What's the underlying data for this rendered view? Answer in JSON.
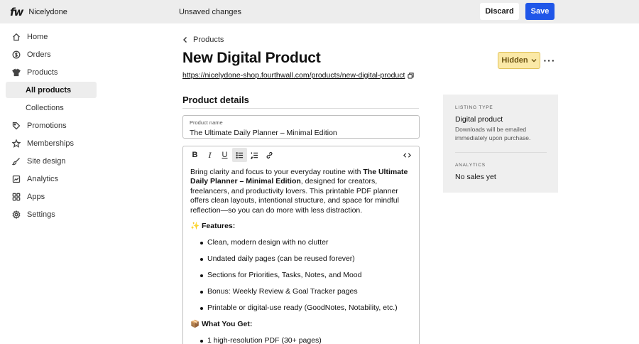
{
  "app": {
    "logo_text": "fw",
    "store_name": "Nicelydone",
    "unsaved_text": "Unsaved changes",
    "discard_label": "Discard",
    "save_label": "Save"
  },
  "sidebar": {
    "items": [
      {
        "label": "Home",
        "icon": "home-icon"
      },
      {
        "label": "Orders",
        "icon": "orders-icon"
      },
      {
        "label": "Products",
        "icon": "shirt-icon"
      },
      {
        "label": "All products",
        "icon": ""
      },
      {
        "label": "Collections",
        "icon": ""
      },
      {
        "label": "Promotions",
        "icon": "tag-icon"
      },
      {
        "label": "Memberships",
        "icon": "star-icon"
      },
      {
        "label": "Site design",
        "icon": "brush-icon"
      },
      {
        "label": "Analytics",
        "icon": "chart-icon"
      },
      {
        "label": "Apps",
        "icon": "apps-icon"
      },
      {
        "label": "Settings",
        "icon": "gear-icon"
      }
    ]
  },
  "main": {
    "breadcrumb": "Products",
    "title": "New Digital Product",
    "url": "https://nicelydone-shop.fourthwall.com/products/new-digital-product",
    "status_label": "Hidden",
    "more_label": "···",
    "section_title": "Product details",
    "product_name_label": "Product name",
    "product_name_value": "The Ultimate Daily Planner – Minimal Edition",
    "toolbar": {
      "bold": "B",
      "italic": "I",
      "underline": "U"
    },
    "description": {
      "intro_prefix": "Bring clarity and focus to your everyday routine with ",
      "intro_bold": "The Ultimate Daily Planner – Minimal Edition",
      "intro_suffix": ", designed for creators, freelancers, and productivity lovers. This printable PDF planner offers clean layouts, intentional structure, and space for mindful reflection—so you can do more with less distraction.",
      "features_heading": "✨ Features:",
      "features": [
        "Clean, modern design with no clutter",
        "Undated daily pages (can be reused forever)",
        "Sections for Priorities, Tasks, Notes, and Mood",
        "Bonus: Weekly Review & Goal Tracker pages",
        "Printable or digital-use ready (GoodNotes, Notability, etc.)"
      ],
      "get_heading": "📦 What You Get:",
      "get_items": [
        "1 high-resolution PDF (30+ pages)"
      ]
    }
  },
  "panel": {
    "listing_kicker": "LISTING TYPE",
    "listing_value": "Digital product",
    "listing_note": "Downloads will be emailed immediately upon purchase.",
    "analytics_kicker": "ANALYTICS",
    "analytics_value": "No sales yet"
  },
  "colors": {
    "accent": "#1f56e8",
    "hidden_badge_bg": "#fbe9a7",
    "topbar_bg": "#ededed"
  }
}
